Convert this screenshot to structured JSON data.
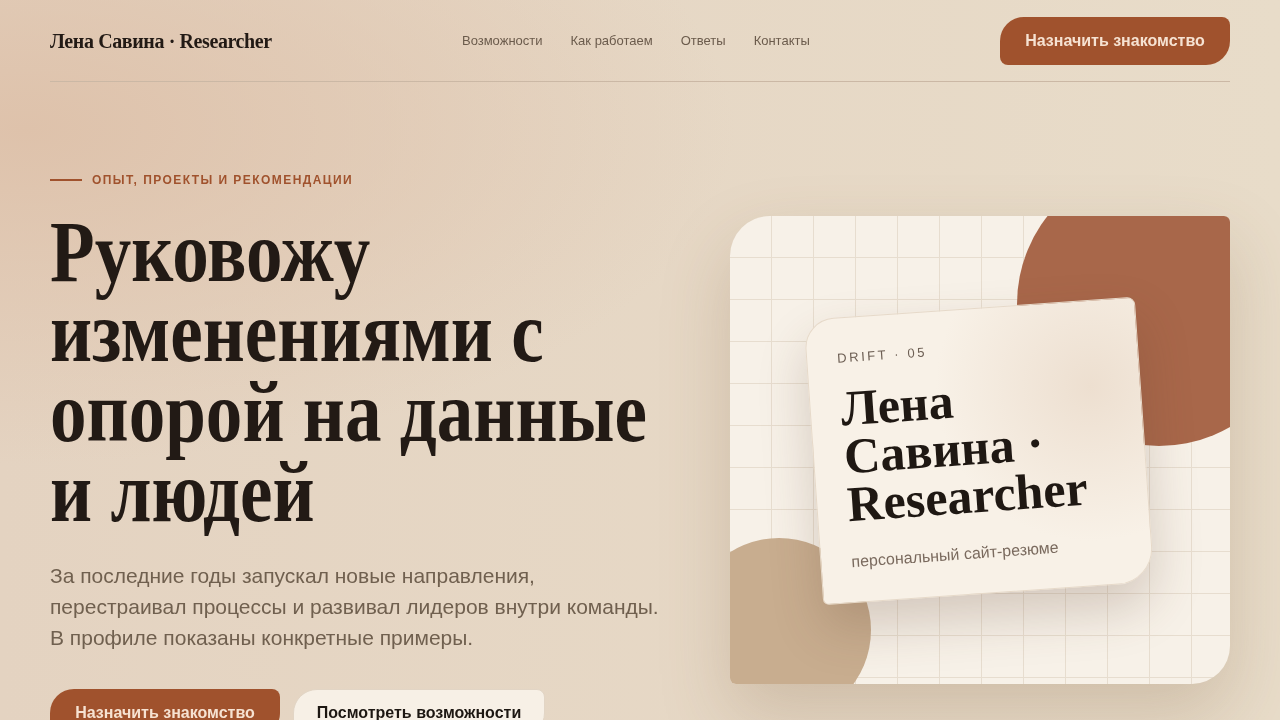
{
  "header": {
    "brand": "Лена Савина · Researcher",
    "nav": [
      "Возможности",
      "Как работаем",
      "Ответы",
      "Контакты"
    ],
    "cta": "Назначить знакомство"
  },
  "hero": {
    "eyebrow": "ОПЫТ, ПРОЕКТЫ И РЕКОМЕНДАЦИИ",
    "title": "Руковожу изменениями с опорой на данные и людей",
    "description": "За последние годы запускал новые направления, перестраивал процессы и развивал лидеров внутри команды. В профиле показаны конкретные примеры.",
    "buttons": [
      {
        "label": "Назначить знакомство",
        "kind": "primary"
      },
      {
        "label": "Посмотреть возможности",
        "kind": "secondary"
      }
    ]
  },
  "showcase": {
    "tag": "DRIFT · 05",
    "title": "Лена Савина · Researcher",
    "subtitle": "персональный сайт-резюме"
  }
}
